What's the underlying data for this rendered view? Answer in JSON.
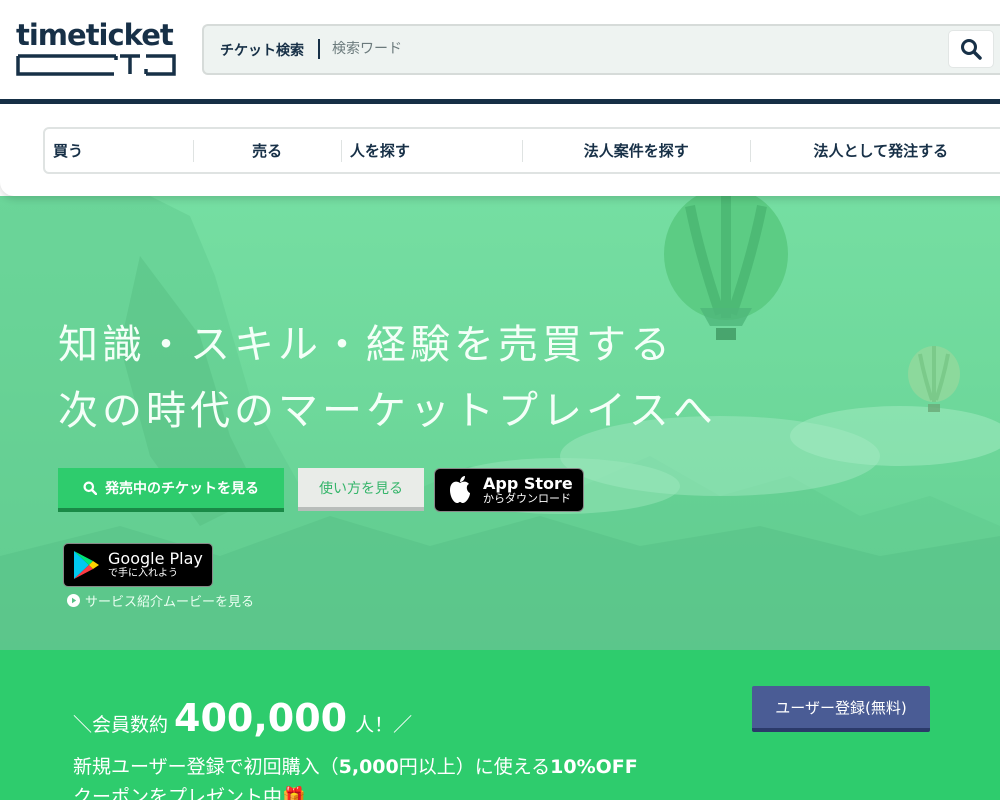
{
  "header": {
    "logo_text": "timeticket",
    "search": {
      "label": "チケット検索",
      "placeholder": "検索ワード",
      "value": ""
    }
  },
  "nav": {
    "items": [
      {
        "label": "買う"
      },
      {
        "label": "売る"
      },
      {
        "label": "人を探す"
      },
      {
        "label": "法人案件を探す"
      },
      {
        "label": "法人として発注する"
      }
    ]
  },
  "hero": {
    "copy_line1": "知識・スキル・経験を売買する",
    "copy_line2": "次の時代のマーケットプレイスへ",
    "primary_button": "発売中のチケットを見る",
    "secondary_button": "使い方を見る",
    "app_store": {
      "title": "App Store",
      "subtitle": "からダウンロード"
    },
    "google_play": {
      "title": "Google Play",
      "subtitle": "で手に入れよう"
    },
    "movie_link": "サービス紹介ムービーを見る"
  },
  "promo": {
    "prefix": "＼会員数約",
    "member_count": "400,000",
    "suffix": "人！／",
    "line2_a": "新規ユーザー登録で初回購入（",
    "line2_amount": "5,000",
    "line2_b": "円以上）に使える",
    "line2_discount": "10%OFF",
    "line3": "クーポンをプレゼント中🎁",
    "register_button": "ユーザー登録(無料)"
  },
  "colors": {
    "navy": "#173047",
    "green": "#2ecc6d",
    "hero_green": "#6fd99c",
    "register_blue": "#4a5c95"
  }
}
